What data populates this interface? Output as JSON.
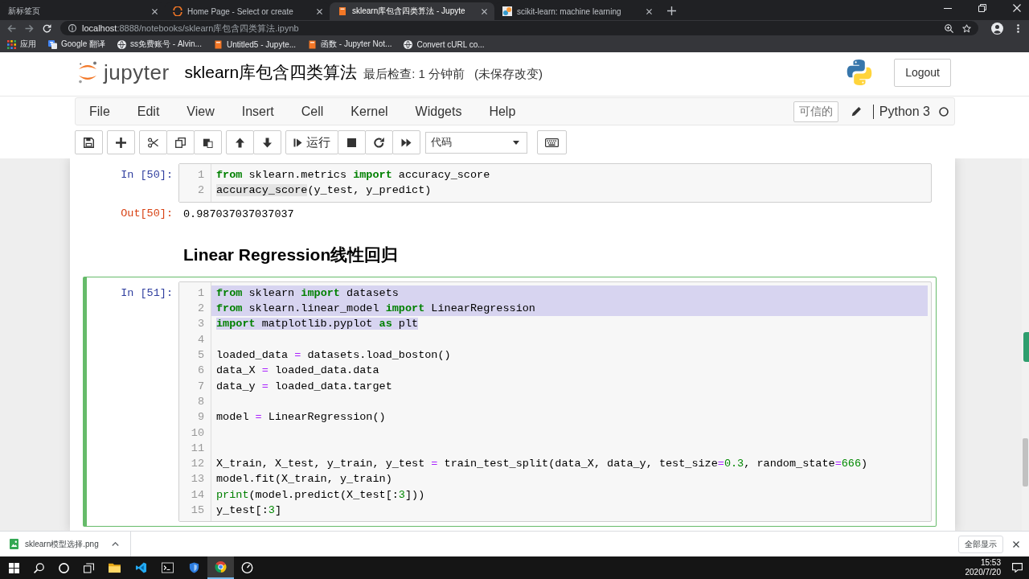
{
  "browser": {
    "tabs": [
      {
        "kind": "blank",
        "title": "新标签页",
        "selected": false
      },
      {
        "kind": "home",
        "title": "Home Page - Select or create",
        "selected": false
      },
      {
        "kind": "notebook",
        "title": "sklearn库包含四类算法 - Jupyte",
        "selected": true
      },
      {
        "kind": "library",
        "title": "scikit-learn: machine learning",
        "selected": false
      }
    ],
    "back": {
      "disabled": true
    },
    "forward": {
      "disabled": true
    },
    "address": {
      "host": "localhost",
      "path": ":8888/notebooks/sklearn库包含四类算法.ipynb"
    },
    "bookmarks": [
      {
        "kind": "apps",
        "title": "应用"
      },
      {
        "kind": "translate",
        "title": "Google 翻译"
      },
      {
        "kind": "globe",
        "title": "ss免费账号 - Alvin..."
      },
      {
        "kind": "notebook",
        "title": "Untitled5 - Jupyte..."
      },
      {
        "kind": "notebook",
        "title": "函数 - Jupyter Not..."
      },
      {
        "kind": "globe",
        "title": "Convert cURL co..."
      }
    ]
  },
  "header": {
    "logo_text": "jupyter",
    "title": "sklearn库包含四类算法",
    "checkpoint": "最后检查: 1 分钟前",
    "save_status": "(未保存改变)",
    "logout": "Logout"
  },
  "menubar": {
    "menus": [
      "File",
      "Edit",
      "View",
      "Insert",
      "Cell",
      "Kernel",
      "Widgets",
      "Help"
    ],
    "trusted": "可信的",
    "kernel_name": "Python 3",
    "kernel_busy": false
  },
  "toolbar": {
    "run_label": "运行",
    "cell_type": "代码"
  },
  "cells": [
    {
      "kind": "code",
      "selected": false,
      "prompt": "In [50]:",
      "lines": [
        {
          "number": "1",
          "selected": false,
          "tokens": [
            {
              "kind": "keyword",
              "text": "from"
            },
            {
              "kind": "plain",
              "text": " sklearn.metrics "
            },
            {
              "kind": "keyword",
              "text": "import"
            },
            {
              "kind": "plain",
              "text": " accuracy_score"
            }
          ]
        },
        {
          "number": "2",
          "selected": false,
          "tokens": [
            {
              "kind": "match",
              "text": "accuracy_score"
            },
            {
              "kind": "plain",
              "text": "(y_test, y_predict)"
            }
          ]
        }
      ],
      "output": {
        "prompt": "Out[50]:",
        "text": "0.987037037037037"
      }
    },
    {
      "kind": "markdown",
      "selected": false,
      "heading": "Linear Regression线性回归"
    },
    {
      "kind": "code",
      "selected": true,
      "prompt": "In [51]:",
      "lines": [
        {
          "number": "1",
          "selected": true,
          "tokens": [
            {
              "kind": "keyword",
              "text": "from"
            },
            {
              "kind": "plain",
              "text": " sklearn "
            },
            {
              "kind": "keyword",
              "text": "import"
            },
            {
              "kind": "plain",
              "text": " datasets"
            }
          ]
        },
        {
          "number": "2",
          "selected": true,
          "tokens": [
            {
              "kind": "keyword",
              "text": "from"
            },
            {
              "kind": "plain",
              "text": " sklearn.linear_model "
            },
            {
              "kind": "keyword",
              "text": "import"
            },
            {
              "kind": "plain",
              "text": " LinearRegression"
            }
          ]
        },
        {
          "number": "3",
          "selected": true,
          "tokens": [
            {
              "kind": "keyword",
              "text": "import"
            },
            {
              "kind": "plain",
              "text": " matplotlib.pyplot "
            },
            {
              "kind": "keyword",
              "text": "as"
            },
            {
              "kind": "plain",
              "text": " plt"
            }
          ]
        },
        {
          "number": "4",
          "selected": false
        },
        {
          "number": "5",
          "selected": false,
          "tokens": [
            {
              "kind": "plain",
              "text": "loaded_data "
            },
            {
              "kind": "operator",
              "text": "="
            },
            {
              "kind": "plain",
              "text": " datasets.load_boston()"
            }
          ]
        },
        {
          "number": "6",
          "selected": false,
          "tokens": [
            {
              "kind": "plain",
              "text": "data_X "
            },
            {
              "kind": "operator",
              "text": "="
            },
            {
              "kind": "plain",
              "text": " loaded_data.data"
            }
          ]
        },
        {
          "number": "7",
          "selected": false,
          "tokens": [
            {
              "kind": "plain",
              "text": "data_y "
            },
            {
              "kind": "operator",
              "text": "="
            },
            {
              "kind": "plain",
              "text": " loaded_data.target"
            }
          ]
        },
        {
          "number": "8",
          "selected": false
        },
        {
          "number": "9",
          "selected": false,
          "tokens": [
            {
              "kind": "plain",
              "text": "model "
            },
            {
              "kind": "operator",
              "text": "="
            },
            {
              "kind": "plain",
              "text": " LinearRegression()"
            }
          ]
        },
        {
          "number": "10",
          "selected": false
        },
        {
          "number": "11",
          "selected": false
        },
        {
          "number": "12",
          "selected": false,
          "tokens": [
            {
              "kind": "plain",
              "text": "X_train, X_test, y_train, y_test "
            },
            {
              "kind": "operator",
              "text": "="
            },
            {
              "kind": "plain",
              "text": " train_test_split(data_X, data_y, test_size"
            },
            {
              "kind": "operator",
              "text": "="
            },
            {
              "kind": "number",
              "text": "0.3"
            },
            {
              "kind": "plain",
              "text": ", random_state"
            },
            {
              "kind": "operator",
              "text": "="
            },
            {
              "kind": "number",
              "text": "666"
            },
            {
              "kind": "plain",
              "text": ")"
            }
          ]
        },
        {
          "number": "13",
          "selected": false,
          "tokens": [
            {
              "kind": "plain",
              "text": "model.fit(X_train, y_train)"
            }
          ]
        },
        {
          "number": "14",
          "selected": false,
          "tokens": [
            {
              "kind": "builtin",
              "text": "print"
            },
            {
              "kind": "plain",
              "text": "(model.predict(X_test[:"
            },
            {
              "kind": "number",
              "text": "3"
            },
            {
              "kind": "plain",
              "text": "]))"
            }
          ]
        },
        {
          "number": "15",
          "selected": false,
          "tokens": [
            {
              "kind": "plain",
              "text": "y_test[:"
            },
            {
              "kind": "number",
              "text": "3"
            },
            {
              "kind": "plain",
              "text": "]"
            }
          ]
        }
      ]
    }
  ],
  "download_bar": {
    "files": [
      {
        "name": "sklearn模型选择.png"
      }
    ],
    "show_all": "全部显示"
  },
  "taskbar": {
    "apps": [
      {
        "kind": "folder",
        "active": false
      },
      {
        "kind": "editor",
        "active": false
      },
      {
        "kind": "terminal",
        "active": false
      },
      {
        "kind": "shield",
        "active": false
      },
      {
        "kind": "browser",
        "active": true
      },
      {
        "kind": "dial",
        "active": false
      }
    ],
    "time": "15:53",
    "date": "2020/7/20"
  }
}
